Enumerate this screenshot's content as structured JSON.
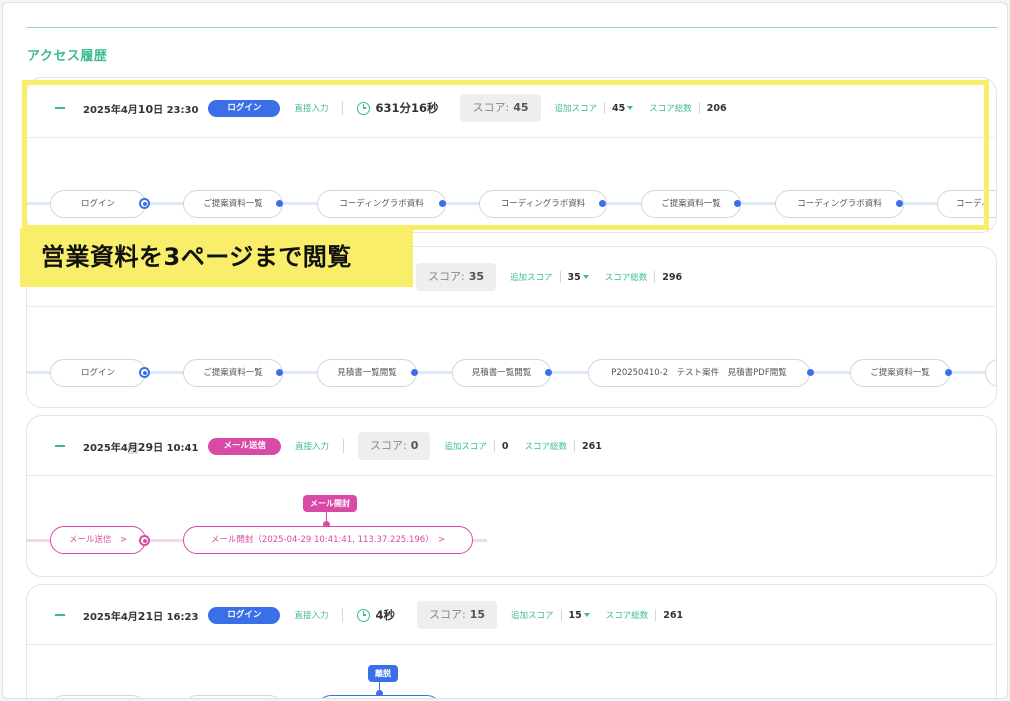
{
  "section_title": "アクセス履歴",
  "caption": "営業資料を3ページまで閲覧",
  "cards": [
    {
      "date_prefix": "2025年4月",
      "day": "10",
      "date_suffix": "日",
      "time": "23:30",
      "badge": "ログイン",
      "direct": "直接入力",
      "duration": "631分16秒",
      "score_label": "スコア:",
      "score_value": "45",
      "add_label": "追加スコア",
      "add_value": "45",
      "total_label": "スコア総数",
      "total_value": "206",
      "nodes": [
        "ログイン",
        "ご提案資料一覧",
        "コーディングラボ資料",
        "コーディングラボ資料",
        "ご提案資料一覧",
        "コーディングラボ資料",
        "コーディ"
      ]
    },
    {
      "score_label": "スコア:",
      "score_value": "35",
      "add_label": "追加スコア",
      "add_value": "35",
      "total_label": "スコア総数",
      "total_value": "296",
      "nodes": [
        "ログイン",
        "ご提案資料一覧",
        "見積書一覧閲覧",
        "見積書一覧閲覧",
        "P20250410-2　テスト案件　見積書PDF閲覧",
        "ご提案資料一覧"
      ]
    },
    {
      "date_prefix": "2025年4",
      "date_hl": "月",
      "day": "29",
      "date_suffix": "日",
      "time": "10:41",
      "badge": "メール送信",
      "direct": "直接入力",
      "score_label": "スコア:",
      "score_value": "0",
      "add_label": "追加スコア",
      "add_value": "0",
      "total_label": "スコア総数",
      "total_value": "261",
      "tag": "メール開封",
      "nodes": [
        "メール送信　>",
        "メール開封（2025-04-29 10:41:41, 113.37.225.196）　>"
      ]
    },
    {
      "date_prefix": "2025年4月",
      "day": "21",
      "date_suffix": "日",
      "time": "16:23",
      "badge": "ログイン",
      "direct": "直接入力",
      "duration": "4秒",
      "score_label": "スコア:",
      "score_value": "15",
      "add_label": "追加スコア",
      "add_value": "15",
      "total_label": "スコア総数",
      "total_value": "261",
      "tag": "離脱"
    }
  ],
  "colors": {
    "accent_green": "#3dbb8f",
    "login_blue": "#3a6fe8",
    "mail_pink": "#d94aa6",
    "highlight_yellow": "#f8ee6a"
  }
}
